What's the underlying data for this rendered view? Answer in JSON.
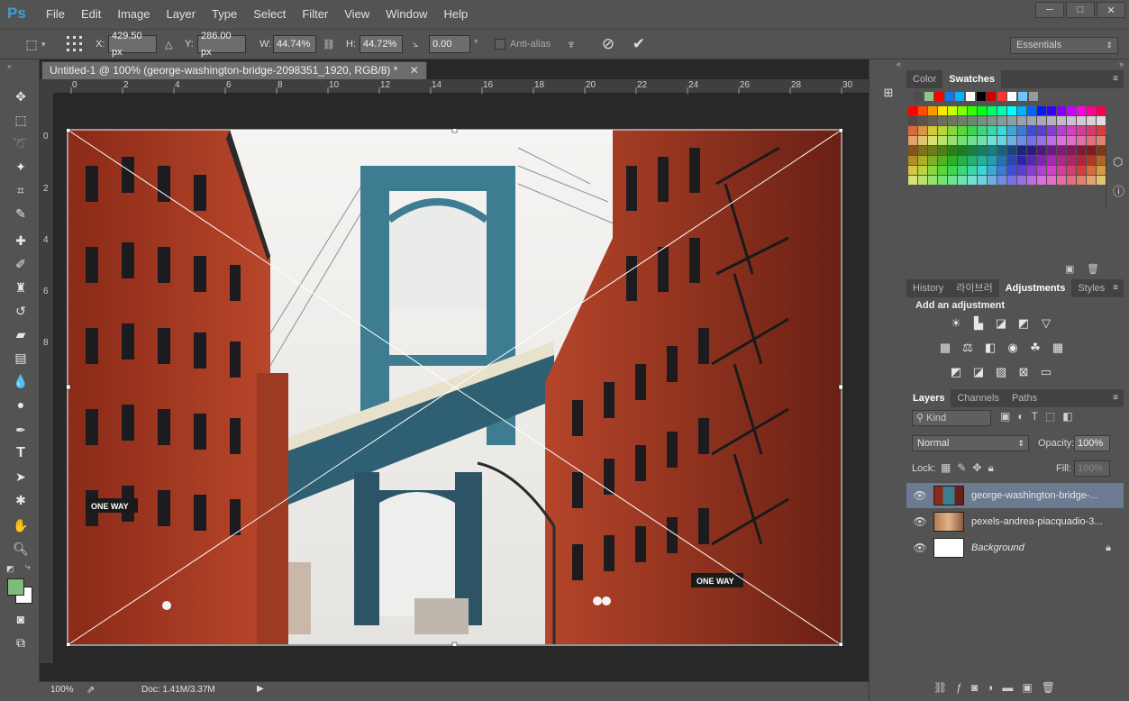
{
  "app": {
    "logo": "Ps"
  },
  "menu": [
    "File",
    "Edit",
    "Image",
    "Layer",
    "Type",
    "Select",
    "Filter",
    "View",
    "Window",
    "Help"
  ],
  "window_controls": [
    "─",
    "□",
    "✕"
  ],
  "options": {
    "x_label": "X:",
    "x_value": "429.50 px",
    "y_label": "Y:",
    "y_value": "286.00 px",
    "w_label": "W:",
    "w_value": "44.74%",
    "h_label": "H:",
    "h_value": "44.72%",
    "angle_value": "0.00",
    "angle_unit": "°",
    "antialias_label": "Anti-alias",
    "workspace": "Essentials"
  },
  "document": {
    "tab_title": "Untitled-1 @ 100% (george-washington-bridge-2098351_1920, RGB/8) *",
    "ruler_top_ticks": [
      "0",
      "2",
      "4",
      "6",
      "8",
      "10",
      "12",
      "14",
      "16",
      "18",
      "20",
      "22",
      "24",
      "26",
      "28",
      "30"
    ],
    "ruler_left_ticks": [
      "0",
      "2",
      "4",
      "6",
      "8"
    ],
    "sign_one_way": "ONE WAY",
    "status_zoom": "100%",
    "status_doc": "Doc: 1.41M/3.37M"
  },
  "panels": {
    "color_tabs": [
      "Color",
      "Swatches"
    ],
    "history_tabs": [
      "History",
      "라이브러",
      "Adjustments",
      "Styles"
    ],
    "add_adjustment": "Add an adjustment",
    "layers_tabs": [
      "Layers",
      "Channels",
      "Paths"
    ],
    "kind_label": "Kind",
    "blend_mode": "Normal",
    "opacity_label": "Opacity:",
    "opacity_value": "100%",
    "lock_label": "Lock:",
    "fill_label": "Fill:",
    "fill_value": "100%",
    "layers": [
      {
        "name": "george-washington-bridge-...",
        "selected": true
      },
      {
        "name": "pexels-andrea-piacquadio-3...",
        "selected": false
      },
      {
        "name": "Background",
        "selected": false,
        "locked": true
      }
    ]
  },
  "colors": {
    "foreground": "#7fbb7b",
    "background": "#ffffff",
    "selected_layer": "#6b7b92"
  }
}
